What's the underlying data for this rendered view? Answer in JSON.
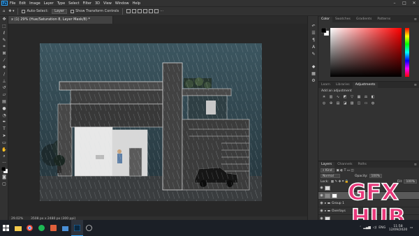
{
  "app": {
    "logo": "Ps"
  },
  "menu": [
    "File",
    "Edit",
    "Image",
    "Layer",
    "Type",
    "Select",
    "Filter",
    "3D",
    "View",
    "Window",
    "Help"
  ],
  "options_bar": {
    "auto_select_label": "Auto-Select:",
    "auto_select_target": "Layer",
    "transform_label": "Show Transform Controls"
  },
  "document": {
    "tab_title": "x (1) 29% (Hue/Saturation 8, Layer Mask/8) *",
    "zoom": "29.02%",
    "doc_size": "3508 px x 2480 px (300 ppi)"
  },
  "toolbar_tools": [
    "move-icon",
    "marquee-icon",
    "lasso-icon",
    "quick-select-icon",
    "crop-icon",
    "frame-icon",
    "eyedropper-icon",
    "healing-icon",
    "brush-icon",
    "stamp-icon",
    "history-brush-icon",
    "eraser-icon",
    "gradient-icon",
    "blur-icon",
    "dodge-icon",
    "pen-icon",
    "type-icon",
    "path-select-icon",
    "shape-icon",
    "hand-icon",
    "zoom-icon",
    "more-icon",
    "color-swatch-icon",
    "quick-mask-icon",
    "screen-mode-icon"
  ],
  "color_panel": {
    "tabs": [
      "Color",
      "Swatches",
      "Gradients",
      "Patterns"
    ],
    "hue_color": "#ff0000",
    "foreground": "#000000",
    "background": "#ffffff"
  },
  "adjustments_panel": {
    "tabs": [
      "Learn",
      "Libraries",
      "Adjustments"
    ],
    "header": "Add an adjustment"
  },
  "layers_panel": {
    "tabs": [
      "Layers",
      "Channels",
      "Paths"
    ],
    "kind_label": "Kind",
    "blend_mode": "Normal",
    "opacity_label": "Opacity:",
    "opacity_value": "100%",
    "lock_label": "Lock:",
    "fill_label": "Fill:",
    "fill_value": "100%",
    "layers": [
      {
        "name": "",
        "selected": false
      },
      {
        "name": "",
        "selected": true
      },
      {
        "name": "Group 1",
        "selected": false
      },
      {
        "name": "Overlays",
        "selected": false
      },
      {
        "name": "",
        "selected": false
      },
      {
        "name": "",
        "selected": false
      }
    ]
  },
  "taskbar": {
    "language": "ENG",
    "time": "11:58",
    "date": "12/09/2020"
  },
  "watermark": {
    "line1": "GFX",
    "line2": "HUB"
  },
  "colors": {
    "accent": "#31a8ff",
    "watermark": "#e8387a",
    "panel_bg": "#323232",
    "app_bg": "#282828"
  }
}
